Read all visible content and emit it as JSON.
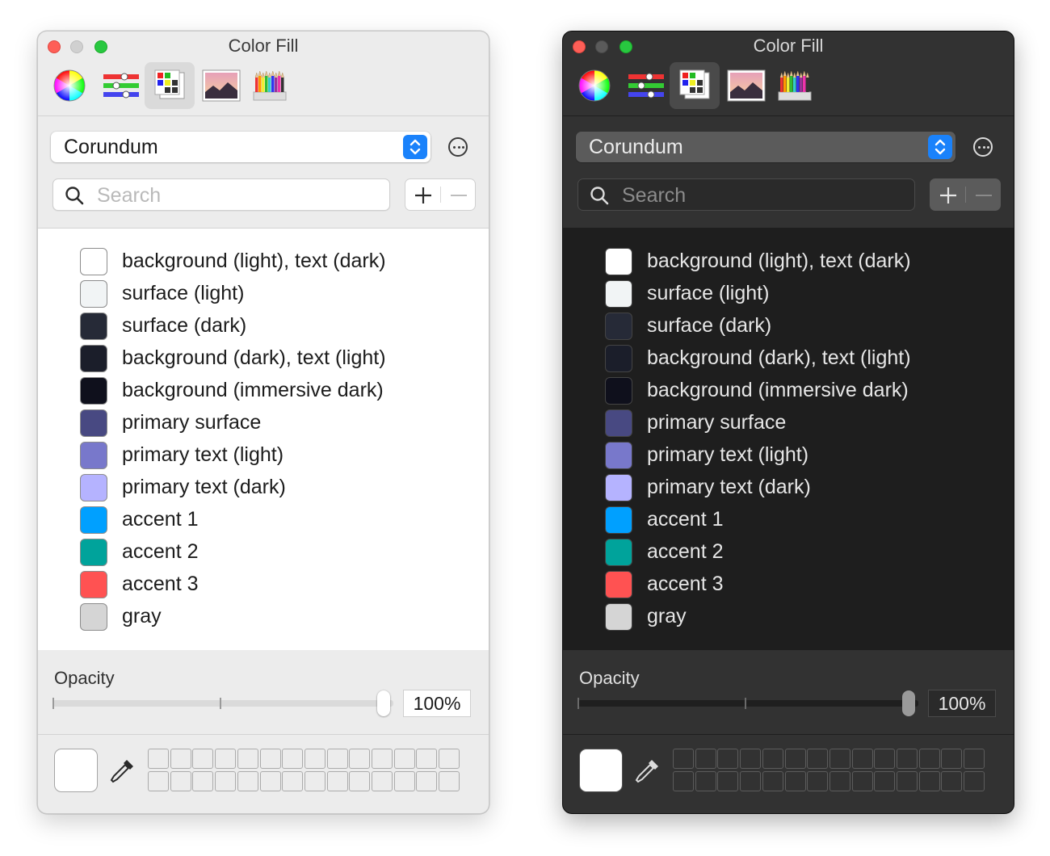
{
  "panels": [
    {
      "theme": "light",
      "window_title": "Color Fill",
      "toolbar_tools": [
        "color-wheel-icon",
        "color-sliders-icon",
        "color-palettes-icon",
        "image-palettes-icon",
        "pencils-icon"
      ],
      "selected_tool": 2,
      "palette_name": "Corundum",
      "search_placeholder": "Search",
      "opacity_label": "Opacity",
      "opacity_value": "100%",
      "opacity_fraction": 1.0
    },
    {
      "theme": "dark",
      "window_title": "Color Fill",
      "toolbar_tools": [
        "color-wheel-icon",
        "color-sliders-icon",
        "color-palettes-icon",
        "image-palettes-icon",
        "pencils-icon"
      ],
      "selected_tool": 2,
      "palette_name": "Corundum",
      "search_placeholder": "Search",
      "opacity_label": "Opacity",
      "opacity_value": "100%",
      "opacity_fraction": 1.0
    }
  ],
  "colors": [
    {
      "label": "background (light), text (dark)",
      "hex": "#ffffff"
    },
    {
      "label": "surface (light)",
      "hex": "#f1f4f5"
    },
    {
      "label": "surface (dark)",
      "hex": "#262a37"
    },
    {
      "label": "background (dark), text (light)",
      "hex": "#1b1e2a"
    },
    {
      "label": "background (immersive dark)",
      "hex": "#0f101c"
    },
    {
      "label": "primary surface",
      "hex": "#484982"
    },
    {
      "label": "primary text (light)",
      "hex": "#7878cb"
    },
    {
      "label": "primary text (dark)",
      "hex": "#b5b3ff"
    },
    {
      "label": "accent 1",
      "hex": "#00a0ff"
    },
    {
      "label": "accent 2",
      "hex": "#00a39b"
    },
    {
      "label": "accent 3",
      "hex": "#ff5252"
    },
    {
      "label": "gray",
      "hex": "#d5d5d5"
    }
  ],
  "current_color": "#ffffff"
}
